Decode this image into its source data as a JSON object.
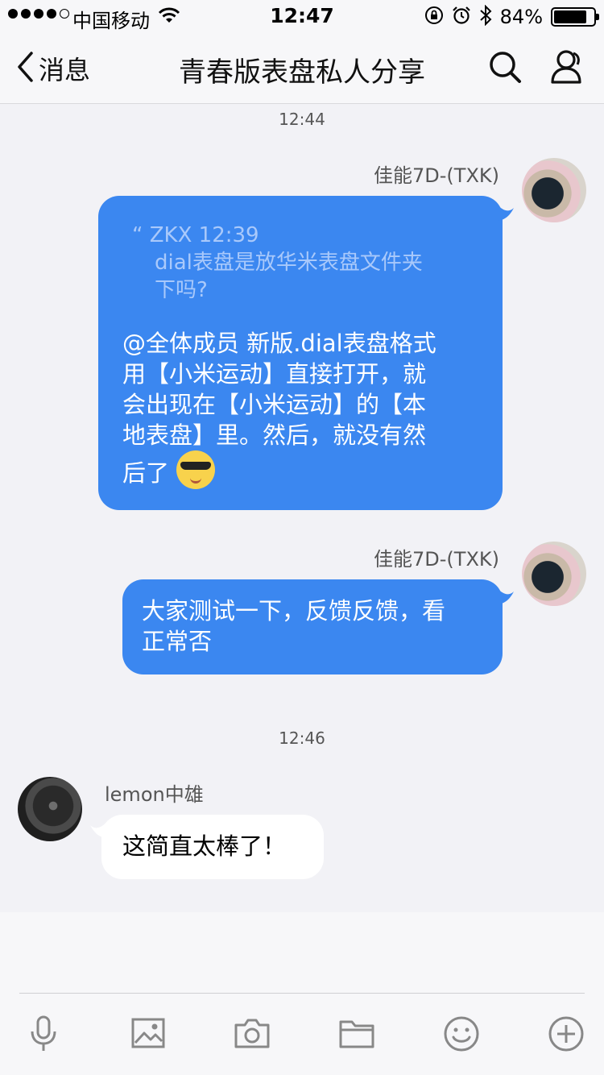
{
  "status_bar": {
    "carrier": "中国移动",
    "time": "12:47",
    "battery_percent": "84%",
    "battery_level": 0.84
  },
  "nav": {
    "back_label": "消息",
    "title": "青春版表盘私人分享"
  },
  "chat": {
    "time_1": "12:44",
    "msg1": {
      "sender": "佳能7D-(TXK)",
      "quote_header": "“ ZKX 12:39",
      "quote_line_1": "dial表盘是放华米表盘文件夹",
      "quote_line_2": "下吗?",
      "line_1": "@全体成员 新版.dial表盘格式",
      "line_2": "用【小米运动】直接打开，就",
      "line_3": "会出现在【小米运动】的【本",
      "line_4": "地表盘】里。然后，就没有然",
      "line_5": "后了"
    },
    "msg2": {
      "sender": "佳能7D-(TXK)",
      "line_1": "大家测试一下，反馈反馈，看",
      "line_2": "正常否"
    },
    "time_2": "12:46",
    "msg3": {
      "sender": "lemon中雄",
      "text": "这简直太棒了！"
    }
  },
  "colors": {
    "bubble_blue": "#3b87f0",
    "background": "#f2f2f6"
  },
  "toolbar": [
    "microphone-icon",
    "image-icon",
    "camera-icon",
    "folder-icon",
    "emoji-icon",
    "plus-icon"
  ]
}
